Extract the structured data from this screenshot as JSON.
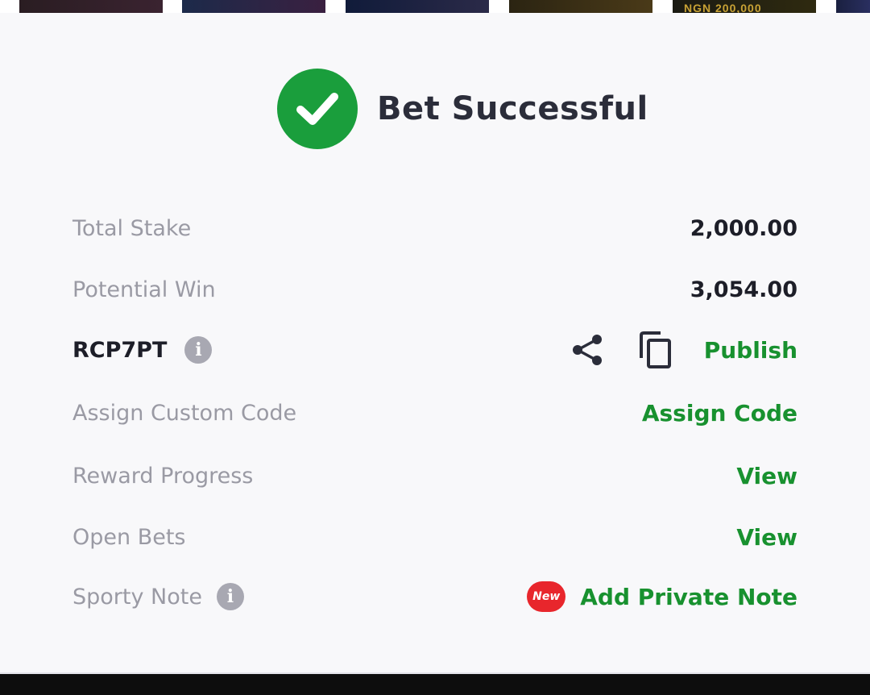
{
  "banner": {
    "prize_text": "NGN 200,000"
  },
  "header": {
    "title": "Bet Successful"
  },
  "summary": {
    "total_stake_label": "Total Stake",
    "total_stake_value": "2,000.00",
    "potential_win_label": "Potential Win",
    "potential_win_value": "3,054.00"
  },
  "booking": {
    "code": "RCP7PT",
    "publish_label": "Publish"
  },
  "actions": {
    "custom_code_label": "Assign Custom Code",
    "custom_code_link": "Assign Code",
    "reward_label": "Reward Progress",
    "reward_link": "View",
    "open_bets_label": "Open Bets",
    "open_bets_link": "View",
    "note_label": "Sporty Note",
    "note_badge": "New",
    "note_link": "Add Private Note"
  },
  "colors": {
    "success_green": "#1a9e3c",
    "link_green": "#18912f",
    "badge_red": "#e8262c"
  },
  "icons": {
    "success": "check-icon",
    "info": "info-icon",
    "share": "share-icon",
    "copy": "copy-icon"
  }
}
